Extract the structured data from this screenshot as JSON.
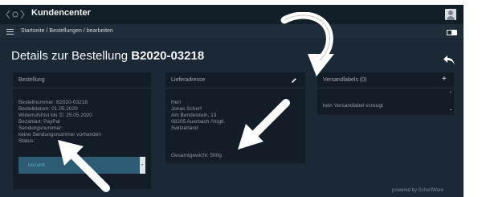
{
  "app": {
    "title": "Kundencenter",
    "icons": {
      "logo": "logo-icon",
      "user": "user-avatar-icon",
      "menu": "hamburger-menu-icon",
      "toggle": "toggle-switch",
      "back": "back-arrow-icon"
    }
  },
  "breadcrumb": "Startseite / Bestellungen / bearbeiten",
  "page": {
    "title_prefix": "Details zur Bestellung",
    "order_number": "B2020-03218"
  },
  "bestellung": {
    "title": "Bestellung",
    "lines": [
      "Bestellnummer: B2020-03218",
      "Bestelldatum: 01.05.2020",
      "Widerrufsfrist bis ➀: 25.05.2020",
      "Bezahlart: PayPal",
      "Sendungsnummer:",
      "keine Sendungsnummer vorhanden",
      "Status:"
    ],
    "status_value": "bezahlt"
  },
  "lieferadresse": {
    "title": "Lieferadresse",
    "edit_icon": "pencil-icon",
    "lines": [
      "Herr",
      "Jonas Scherf",
      "Am Bendelstein, 13",
      "08205 Auerbach /Vogtl.",
      "Switzerland"
    ],
    "gesamtgewicht": "Gesamtgewicht: 500g"
  },
  "versand": {
    "title": "Versandlabels (0)",
    "add_icon": "plus-icon",
    "add_label": "+",
    "empty_text": "kein Versandlabel erzeugt"
  },
  "footer": "powered by ScherfWare",
  "colors": {
    "app_background": "#1b2936",
    "topbar": "#121e28",
    "card": "#121d27",
    "status_select": "#2e5b74",
    "status_text": "#53a7bf",
    "annotation_arrow": "#ffffff"
  }
}
